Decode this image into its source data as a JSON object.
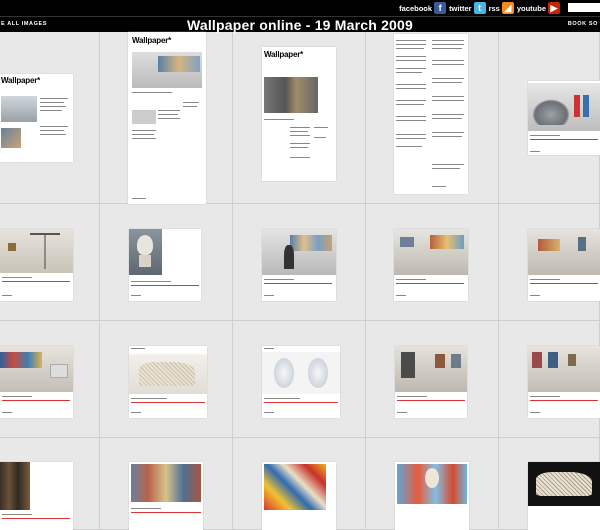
{
  "header": {
    "title": "Wallpaper online - 19 March 2009",
    "see_all": "E ALL IMAGES",
    "book": "BOOK SO"
  },
  "social": [
    {
      "label": "facebook",
      "icon": "facebook-icon",
      "color": "#3b5998",
      "glyph": "f"
    },
    {
      "label": "twitter",
      "icon": "twitter-icon",
      "color": "#4ab3e8",
      "glyph": "t"
    },
    {
      "label": "rss",
      "icon": "rss-icon",
      "color": "#f28a1c",
      "glyph": "◢"
    },
    {
      "label": "youtube",
      "icon": "youtube-icon",
      "color": "#cc2200",
      "glyph": "▶"
    }
  ],
  "pages": {
    "logo": "Wallpaper*"
  },
  "colors": {
    "bar": "#000000",
    "background": "#e8e8e8",
    "accent_red": "#d33333"
  }
}
